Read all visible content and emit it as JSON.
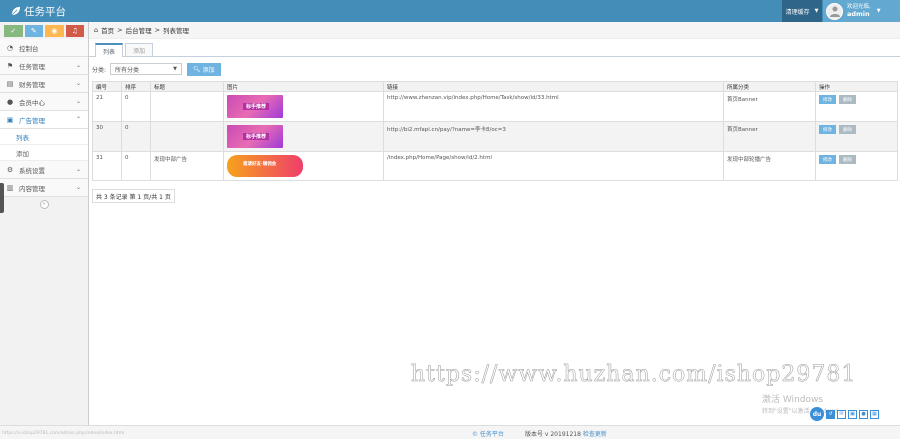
{
  "header": {
    "brand": "任务平台",
    "clear_cache": "清理缓存",
    "welcome": "欢迎光临,",
    "username": "admin"
  },
  "colors": {
    "topbar": "#438eb9",
    "accent": "#2b7dbc",
    "shortcut_green": "#87b87f",
    "shortcut_blue": "#6fb3e0",
    "shortcut_orange": "#ffb752",
    "shortcut_red": "#d15b47"
  },
  "sidebar": {
    "items": [
      {
        "label": "控制台",
        "icon": "tachometer-icon"
      },
      {
        "label": "任务管理",
        "icon": "flag-icon"
      },
      {
        "label": "财务管理",
        "icon": "ticket-icon"
      },
      {
        "label": "会员中心",
        "icon": "user-icon"
      },
      {
        "label": "广告管理",
        "icon": "picture-icon"
      },
      {
        "label": "系统设置",
        "icon": "gear-icon"
      },
      {
        "label": "内容管理",
        "icon": "book-icon"
      }
    ],
    "sub_items": [
      {
        "label": "列表"
      },
      {
        "label": "添加"
      }
    ]
  },
  "breadcrumb": {
    "home": "首页",
    "sep": ">",
    "level2": "后台管理",
    "level3": "列表管理"
  },
  "tabs": [
    {
      "label": "列表"
    },
    {
      "label": "添加"
    }
  ],
  "filter": {
    "label": "分类:",
    "selected": "所有分类",
    "add_button": "添加"
  },
  "table": {
    "headers": [
      "编号",
      "排序",
      "标题",
      "图片",
      "链接",
      "所属分类",
      "操作"
    ],
    "rows": [
      {
        "id": "21",
        "sort": "0",
        "title": "",
        "image_text": "标手推荐",
        "link": "http://www.zhenzan.vip/index.php/Home/Task/show/id/33.html",
        "category": "首页Banner"
      },
      {
        "id": "30",
        "sort": "0",
        "title": "",
        "image_text": "标手推荐",
        "link": "http://bi2.mfapi.cn/pay/?name=李卡8/oc=3",
        "category": "首页Banner"
      },
      {
        "id": "31",
        "sort": "0",
        "title": "发现中部广告",
        "image_text": "邀请好友·赚佣金",
        "link": "/index.php/Home/Page/show/id/2.html",
        "category": "发现中部轮播广告"
      }
    ],
    "edit_label": "修改",
    "delete_label": "删除"
  },
  "pager": {
    "text": "共 3 条记录 第 1 页/共 1 页"
  },
  "watermark": "https://www.huzhan.com/ishop29781",
  "windows_notice": {
    "title": "激活 Windows",
    "subtitle": "转到\"设置\"以激活 Windows。"
  },
  "footer": {
    "brand": "© 任务平台",
    "version_label": "版本号 v 20191218",
    "update_link": "检查更新"
  },
  "status_url": "https://v.ishop29781.com/admin.php/index/index.html"
}
